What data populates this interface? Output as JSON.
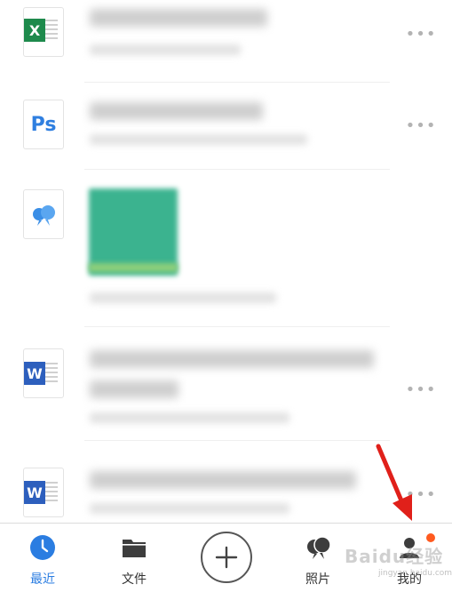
{
  "tabs": [
    {
      "key": "recent",
      "label": "最近",
      "icon": "clock-icon",
      "active": true
    },
    {
      "key": "files",
      "label": "文件",
      "icon": "folder-icon",
      "active": false
    },
    {
      "key": "add",
      "label": "",
      "icon": "plus-icon",
      "active": false
    },
    {
      "key": "photos",
      "label": "照片",
      "icon": "photos-icon",
      "active": false
    },
    {
      "key": "mine",
      "label": "我的",
      "icon": "person-icon",
      "active": false
    }
  ],
  "file_badges": {
    "excel": "X",
    "ps": "Ps",
    "word": "W"
  },
  "more_glyph": "•••",
  "watermark": {
    "text": "Baidu经验",
    "sub": "jingyan.baidu.com"
  },
  "colors": {
    "accent": "#2b7de1",
    "excel": "#1e8a4c",
    "ps": "#2f7fe0",
    "word": "#2d5fbd",
    "notification": "#ff5a1f",
    "arrow": "#e0201a"
  }
}
